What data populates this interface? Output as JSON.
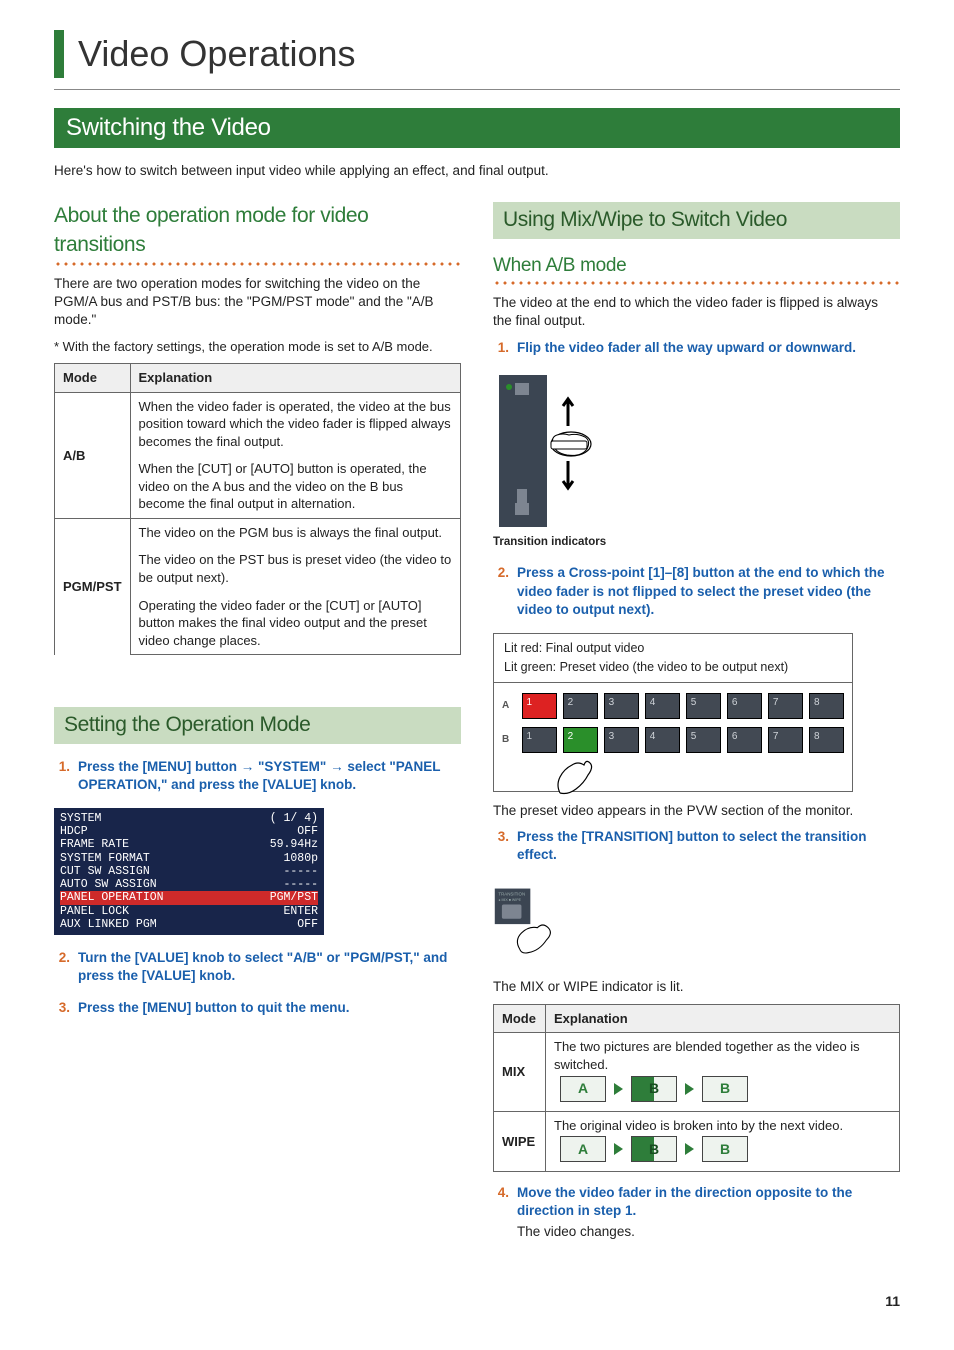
{
  "page_title": "Video Operations",
  "section_title": "Switching the Video",
  "intro": "Here's how to switch between input video while applying an effect, and final output.",
  "about": {
    "heading": "About the operation mode for video transitions",
    "p1": "There are two operation modes for switching the video on the PGM/A bus and PST/B bus: the \"PGM/PST mode\" and the \"A/B mode.\"",
    "note": "*  With the factory settings, the operation mode is set to A/B mode.",
    "table": {
      "h_mode": "Mode",
      "h_expl": "Explanation",
      "ab_label": "A/B",
      "ab_e1": "When the video fader is operated, the video at the bus position toward which the video fader is flipped always becomes the final output.",
      "ab_e2": "When the [CUT] or [AUTO] button is operated, the video on the A bus and the video on the B bus become the final output in alternation.",
      "pgm_label": "PGM/PST",
      "pgm_e1": "The video on the PGM bus is always the final output.",
      "pgm_e2": "The video on the PST bus is preset video (the video to be output next).",
      "pgm_e3": "Operating the video fader or the [CUT] or [AUTO] button makes the final video output and the preset video change places."
    }
  },
  "setting": {
    "heading": "Setting the Operation Mode",
    "step1": "Press the [MENU] button → \"SYSTEM\" → select \"PANEL OPERATION,\" and press the [VALUE] knob.",
    "step2": "Turn the [VALUE] knob to select \"A/B\" or \"PGM/PST,\" and press the [VALUE] knob.",
    "step3": "Press the [MENU] button to quit the menu.",
    "menu": {
      "title": "SYSTEM",
      "page": "( 1/ 4)",
      "rows": [
        {
          "l": "HDCP",
          "r": "OFF"
        },
        {
          "l": "FRAME RATE",
          "r": "59.94Hz"
        },
        {
          "l": "SYSTEM FORMAT",
          "r": "1080p"
        },
        {
          "l": "CUT SW ASSIGN",
          "r": "-----"
        },
        {
          "l": "AUTO SW ASSIGN",
          "r": "-----"
        },
        {
          "l": "PANEL OPERATION",
          "r": "PGM/PST"
        },
        {
          "l": "PANEL LOCK",
          "r": "ENTER"
        },
        {
          "l": "AUX LINKED PGM",
          "r": "OFF"
        }
      ],
      "highlight_index": 5
    }
  },
  "using": {
    "heading": "Using Mix/Wipe to Switch Video",
    "abmode_heading": "When A/B mode",
    "abmode_p": "The video at the end to which the video fader is flipped is always the final output.",
    "step1": "Flip the video fader all the way upward or downward.",
    "fig1_caption": "Transition indicators",
    "step2": "Press a Cross-point [1]–[8] button at the end to which the video fader is not flipped to select the preset video (the video to output next).",
    "legend_red": "Lit red:    Final output video",
    "legend_green": "Lit green: Preset video (the video to be output next)",
    "row_a": "A",
    "row_b": "B",
    "after_fig2": "The preset video appears in the PVW section of the monitor.",
    "step3": "Press the [TRANSITION] button to select the transition effect.",
    "after_fig3": "The MIX or WIPE indicator is lit.",
    "tbl": {
      "h_mode": "Mode",
      "h_expl": "Explanation",
      "mix_label": "MIX",
      "mix_expl": "The two pictures are blended together as the video is switched.",
      "wipe_label": "WIPE",
      "wipe_expl": "The original video is broken into by the next video."
    },
    "step4": "Move the video fader in the direction opposite to the direction in step 1.",
    "step4_after": "The video changes.",
    "seq_a": "A",
    "seq_b": "B"
  },
  "page_number": "11"
}
